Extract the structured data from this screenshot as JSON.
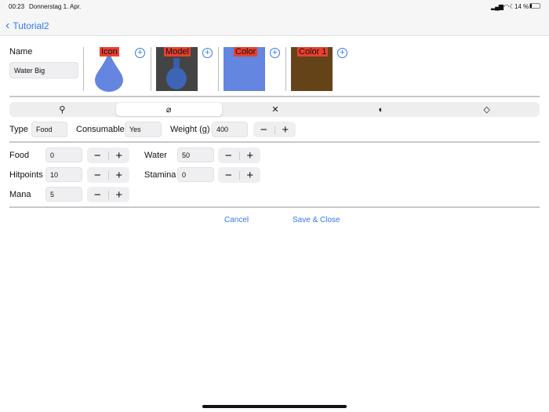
{
  "status": {
    "time": "00:23",
    "date": "Donnerstag 1. Apr.",
    "battery": "14 %"
  },
  "nav": {
    "back_label": "Tutorial2"
  },
  "name": {
    "label": "Name",
    "value": "Water Big"
  },
  "assets": [
    {
      "label": "Icon",
      "color": "#6485e0"
    },
    {
      "label": "Model",
      "color": "#444444"
    },
    {
      "label": "Color",
      "color": "#6485e0"
    },
    {
      "label": "Color 1",
      "color": "#654319"
    }
  ],
  "tabs": [
    {
      "icon": "key-icon"
    },
    {
      "icon": "leaf-icon",
      "selected": true
    },
    {
      "icon": "crossed-swords-icon",
      "glyph": "✕"
    },
    {
      "icon": "shield-icon",
      "glyph": "◐"
    },
    {
      "icon": "tag-icon",
      "glyph": "◇"
    }
  ],
  "general": {
    "type_label": "Type",
    "type_value": "Food",
    "consumable_label": "Consumable",
    "consumable_value": "Yes",
    "weight_label": "Weight (g)",
    "weight_value": "400"
  },
  "stats": {
    "food": {
      "label": "Food",
      "value": "0"
    },
    "water": {
      "label": "Water",
      "value": "50"
    },
    "hitpoints": {
      "label": "Hitpoints",
      "value": "10"
    },
    "stamina": {
      "label": "Stamina",
      "value": "0"
    },
    "mana": {
      "label": "Mana",
      "value": "5"
    }
  },
  "stepper": {
    "minus": "−",
    "plus": "+"
  },
  "actions": {
    "cancel": "Cancel",
    "save": "Save & Close"
  }
}
